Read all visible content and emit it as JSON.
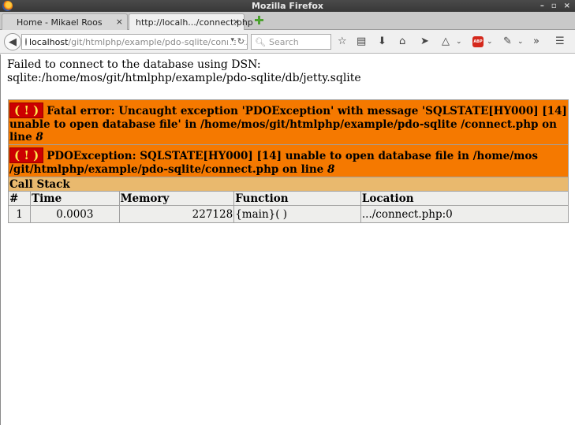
{
  "window": {
    "title": "Mozilla Firefox",
    "controls": [
      "–",
      "▫",
      "×"
    ]
  },
  "tabs": [
    {
      "label": "Home - Mikael Roos",
      "close": "×",
      "active": false
    },
    {
      "label": "http://localh.../connect.php",
      "close": "×",
      "active": true
    }
  ],
  "navbar": {
    "url_host": "localhost",
    "url_rest": "/git/htmlphp/example/pdo-sqlite/connect.p",
    "search_placeholder": "Search",
    "abp_label": "ABP"
  },
  "page": {
    "message_line1": "Failed to connect to the database using DSN:",
    "message_line2": "sqlite:/home/mos/git/htmlphp/example/pdo-sqlite/db/jetty.sqlite",
    "error_icon": "( ! )",
    "fatal_error_text": "Fatal error: Uncaught exception 'PDOException' with message 'SQLSTATE[HY000] [14] unable to open database file' in /home/mos/git/htmlphp/example/pdo-sqlite /connect.php on line ",
    "fatal_error_line": "8",
    "pdo_exception_text": "PDOException: SQLSTATE[HY000] [14] unable to open database file in /home/mos /git/htmlphp/example/pdo-sqlite/connect.php on line ",
    "pdo_exception_line": "8",
    "call_stack_title": "Call Stack",
    "columns": [
      "#",
      "Time",
      "Memory",
      "Function",
      "Location"
    ],
    "rows": [
      {
        "num": "1",
        "time": "0.0003",
        "memory": "227128",
        "function": "{main}( )",
        "location": ".../connect.php:0"
      }
    ]
  },
  "colors": {
    "error_bg": "#f57900",
    "call_stack_bg": "#e9b96e",
    "row_bg": "#eeeeec",
    "icon_bg": "#cc0000"
  }
}
